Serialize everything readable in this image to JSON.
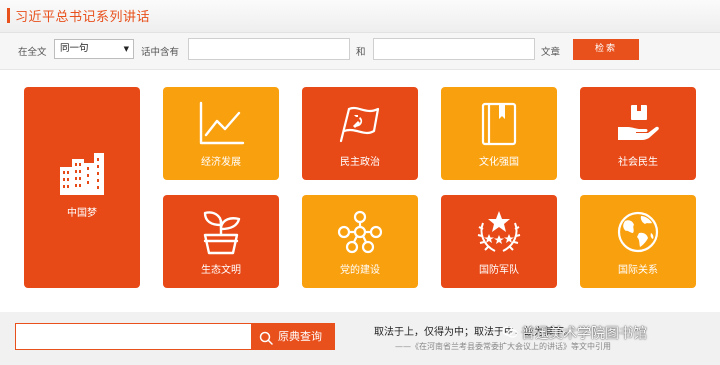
{
  "header": {
    "title": "习近平总书记系列讲话"
  },
  "search": {
    "scope_label": "在全文",
    "scope_value": "同一句",
    "contains_label": "话中含有",
    "and_label": "和",
    "article_label": "文章",
    "button_label": "检索"
  },
  "tiles": [
    {
      "label": "中国梦",
      "icon": "city-buildings-icon"
    },
    {
      "label": "经济发展",
      "icon": "line-chart-icon"
    },
    {
      "label": "民主政治",
      "icon": "party-flag-icon"
    },
    {
      "label": "文化强国",
      "icon": "book-icon"
    },
    {
      "label": "社会民生",
      "icon": "hand-box-icon"
    },
    {
      "label": "生态文明",
      "icon": "plant-icon"
    },
    {
      "label": "党的建设",
      "icon": "network-icon"
    },
    {
      "label": "国防军队",
      "icon": "army-emblem-icon"
    },
    {
      "label": "国际关系",
      "icon": "globe-icon"
    }
  ],
  "bottom": {
    "search_button": "原典查询",
    "quote": "取法于上，仅得为中；取法于中，故为其下。",
    "quote_source": "——《在河南省兰考县委常委扩大会议上的讲话》等文中引用",
    "watermark": "普迅美术学院图书馆"
  },
  "colors": {
    "red": "#e84a17",
    "orange": "#f9a00f",
    "accent": "#e8501c"
  }
}
